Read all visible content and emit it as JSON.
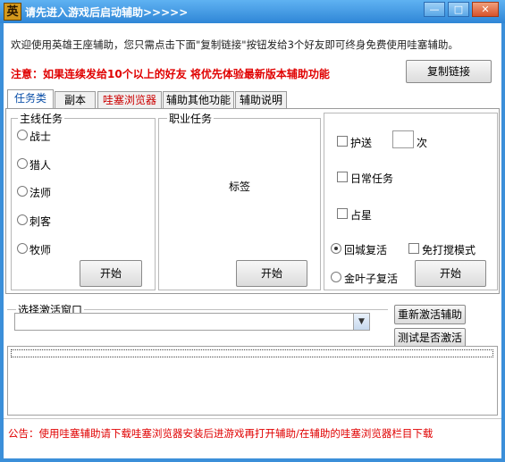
{
  "window": {
    "title": "请先进入游戏后启动辅助>>>>>",
    "icon_glyph": "英",
    "minimize_glyph": "—",
    "maximize_glyph": "□",
    "close_glyph": "✕"
  },
  "header": {
    "intro": "欢迎使用英雄王座辅助，您只需点击下面\"复制链接\"按钮发给3个好友即可终身免费使用哇塞辅助。",
    "notice": "注意：如果连续发给10个以上的好友 将优先体验最新版本辅助功能",
    "copy_link_label": "复制链接"
  },
  "tabs": [
    {
      "label": "任务类",
      "active": true
    },
    {
      "label": "副本",
      "active": false
    },
    {
      "label": "哇塞浏览器",
      "active": false,
      "color": "#cc0000"
    },
    {
      "label": "辅助其他功能",
      "active": false
    },
    {
      "label": "辅助说明",
      "active": false
    }
  ],
  "main_task": {
    "title": "主线任务",
    "options": [
      "战士",
      "猎人",
      "法师",
      "刺客",
      "牧师"
    ],
    "start_label": "开始"
  },
  "job_task": {
    "title": "职业任务",
    "placeholder_label": "标签",
    "start_label": "开始"
  },
  "extra": {
    "escort_label": "护送",
    "times_value": "",
    "times_label": "次",
    "daily_label": "日常任务",
    "divination_label": "占星",
    "return_revive_label": "回城复活",
    "no_disturb_label": "免打搅模式",
    "gold_leaf_revive_label": "金叶子复活",
    "start_label": "开始"
  },
  "activation": {
    "title": "选择激活窗口",
    "selected_value": "",
    "reactivate_label": "重新激活辅助",
    "test_label": "测试是否激活"
  },
  "footer": {
    "announcement": "公告：使用哇塞辅助请下载哇塞浏览器安装后进游戏再打开辅助/在辅助的哇塞浏览器栏目下载"
  },
  "colors": {
    "titlebar": "#3b8fd9",
    "notice_red": "#e00000",
    "tab_active_text": "#0b4fa8"
  }
}
